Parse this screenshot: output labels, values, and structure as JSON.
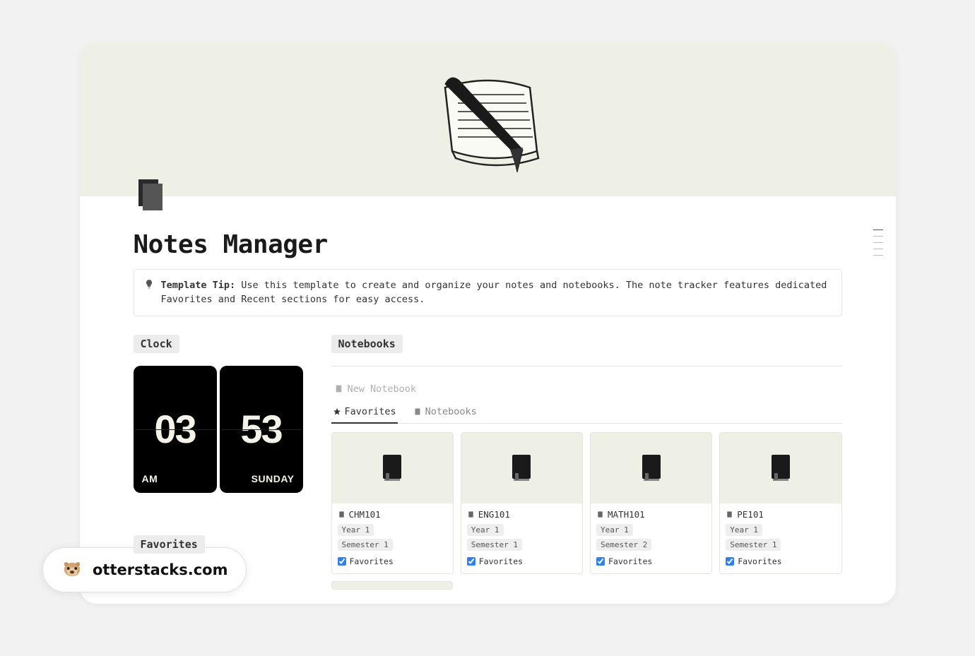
{
  "page_title": "Notes Manager",
  "tip": {
    "label": "Template Tip:",
    "text": " Use this template to create and organize your notes and notebooks. The note tracker features dedicated Favorites and Recent sections for easy access."
  },
  "clock": {
    "label": "Clock",
    "hour": "03",
    "minute": "53",
    "ampm": "AM",
    "day": "SUNDAY"
  },
  "favorites_label": "Favorites",
  "notebooks": {
    "label": "Notebooks",
    "new_label": "New Notebook",
    "tabs": {
      "favorites": "Favorites",
      "all": "Notebooks"
    },
    "cards": [
      {
        "title": "CHM101",
        "year": "Year 1",
        "semester": "Semester 1",
        "fav_label": "Favorites"
      },
      {
        "title": "ENG101",
        "year": "Year 1",
        "semester": "Semester 1",
        "fav_label": "Favorites"
      },
      {
        "title": "MATH101",
        "year": "Year 1",
        "semester": "Semester 2",
        "fav_label": "Favorites"
      },
      {
        "title": "PE101",
        "year": "Year 1",
        "semester": "Semester 1",
        "fav_label": "Favorites"
      }
    ]
  },
  "badge": "otterstacks.com"
}
